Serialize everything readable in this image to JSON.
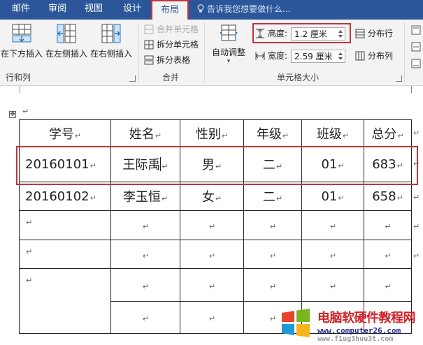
{
  "tabs": {
    "mailings": "邮件",
    "review": "审阅",
    "view": "视图",
    "design": "设计",
    "layout": "布局"
  },
  "tell_me": {
    "placeholder": "告诉我您想要做什么..."
  },
  "ribbon": {
    "rows_cols": {
      "insert_below": "在下方插入",
      "insert_left": "在左侧插入",
      "insert_right": "在右侧插入",
      "group_label": "行和列"
    },
    "merge": {
      "merge_cells": "合并单元格",
      "split_cells": "拆分单元格",
      "split_table": "拆分表格",
      "group_label": "合并"
    },
    "cell_size": {
      "autofit": "自动调整",
      "height_label": "高度:",
      "height_value": "1.2 厘米",
      "width_label": "宽度:",
      "width_value": "2.59 厘米",
      "distribute_rows": "分布行",
      "distribute_cols": "分布列",
      "group_label": "单元格大小"
    }
  },
  "table": {
    "headers": [
      "学号",
      "姓名",
      "性别",
      "年级",
      "班级",
      "总分"
    ],
    "rows": [
      [
        "20160101",
        "王际禹",
        "男",
        "二",
        "01",
        "683"
      ],
      [
        "20160102",
        "李玉恒",
        "女",
        "二",
        "01",
        "658"
      ]
    ]
  },
  "paragraph_mark": "↵",
  "watermark": {
    "title": "电脑软硬件教程网",
    "url1": "www.computer26.com",
    "url2": "www.f1ug3huu3t.com"
  },
  "colors": {
    "title_bar": "#2b579a",
    "highlight": "#c0353d",
    "watermark_red": "#d2232a"
  }
}
